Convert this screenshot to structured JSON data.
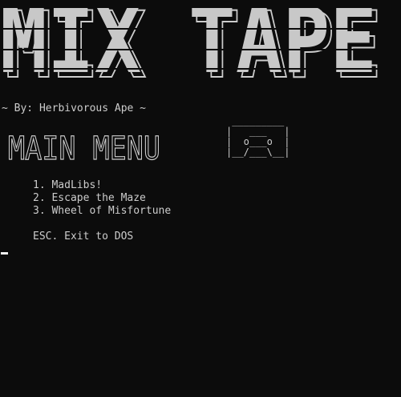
{
  "banner": {
    "title": "MIX TAPE"
  },
  "byline": "~ By: Herbivorous Ape ~",
  "menu": {
    "heading": "MAIN MENU",
    "items": [
      {
        "label": "1. MadLibs!"
      },
      {
        "label": "2. Escape the Maze"
      },
      {
        "label": "3. Wheel of Misfortune"
      }
    ],
    "exit_label": "ESC. Exit to DOS"
  },
  "face_art": " _________\n|   ___   |\n|  o___o  |\n|__/___\\__|",
  "colors": {
    "background": "#0c0c0c",
    "text": "#cccccc",
    "banner_fill": "#c8c8c8",
    "cursor": "#f2f2f2"
  }
}
